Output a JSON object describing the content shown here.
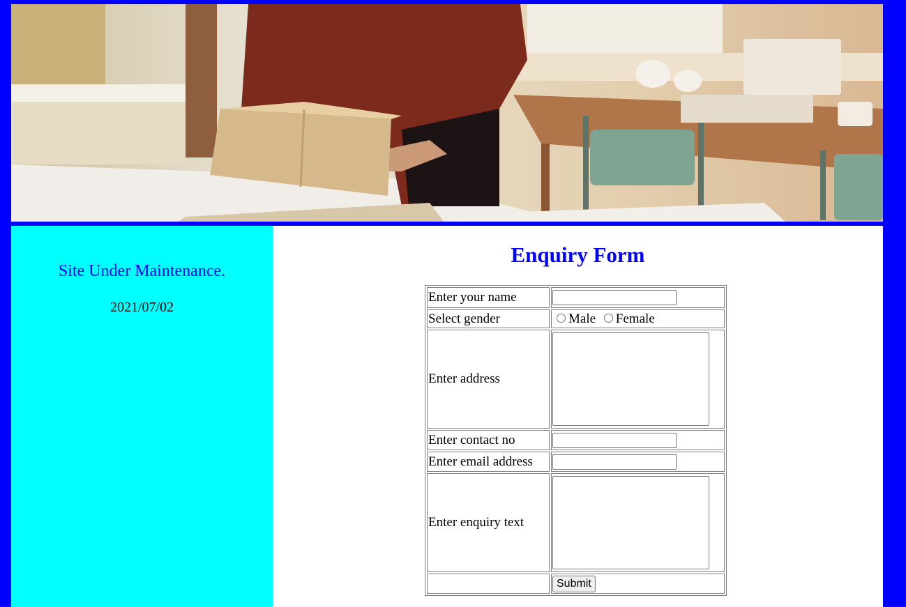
{
  "banner": {
    "alt": "person packing a cardboard box at a table"
  },
  "sidebar": {
    "notice": "Site Under Maintenance.",
    "date": "2021/07/02"
  },
  "form": {
    "title": "Enquiry Form",
    "name_label": "Enter your name",
    "name_value": "",
    "gender_label": "Select gender",
    "gender_options": [
      "Male",
      "Female"
    ],
    "address_label": "Enter address",
    "address_value": "",
    "contact_label": "Enter contact no",
    "contact_value": "",
    "email_label": "Enter email address",
    "email_value": "",
    "enquiry_label": "Enter enquiry text",
    "enquiry_value": "",
    "submit_label": "Submit"
  },
  "colors": {
    "background": "#0000ff",
    "sidebar": "#00ffff",
    "title": "#0000ff"
  }
}
